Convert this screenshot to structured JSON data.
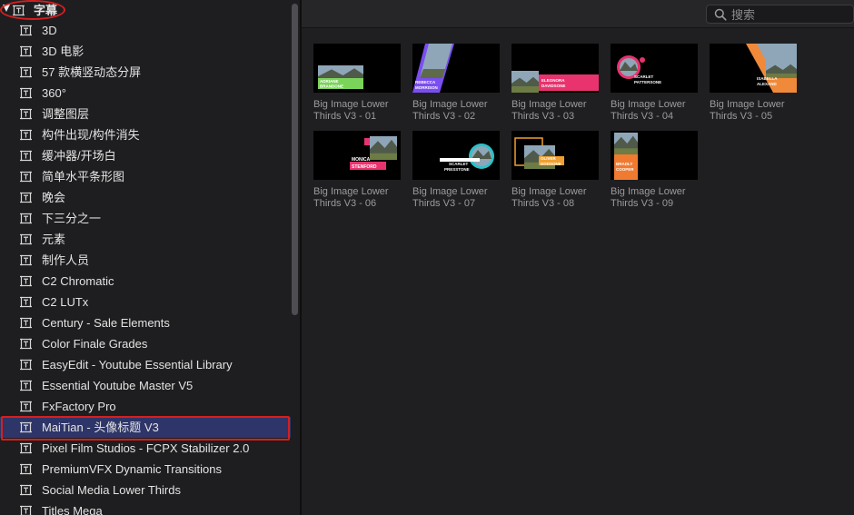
{
  "sidebar": {
    "header": {
      "label": "字幕"
    },
    "items": [
      {
        "label": "3D"
      },
      {
        "label": "3D 电影"
      },
      {
        "label": "57 款横竖动态分屏"
      },
      {
        "label": "360°"
      },
      {
        "label": "调整图层"
      },
      {
        "label": "构件出现/构件消失"
      },
      {
        "label": "缓冲器/开场白"
      },
      {
        "label": "简单水平条形图"
      },
      {
        "label": "晚会"
      },
      {
        "label": "下三分之一"
      },
      {
        "label": "元素"
      },
      {
        "label": "制作人员"
      },
      {
        "label": "C2 Chromatic"
      },
      {
        "label": "C2 LUTx"
      },
      {
        "label": "Century - Sale Elements"
      },
      {
        "label": "Color Finale Grades"
      },
      {
        "label": "EasyEdit - Youtube Essential Library"
      },
      {
        "label": "Essential Youtube Master V5"
      },
      {
        "label": "FxFactory Pro"
      },
      {
        "label": "MaiTian - 头像标题 V3",
        "selected": true
      },
      {
        "label": "Pixel Film Studios - FCPX Stabilizer 2.0"
      },
      {
        "label": "PremiumVFX Dynamic Transitions"
      },
      {
        "label": "Social Media Lower Thirds"
      },
      {
        "label": "Titles Mega"
      }
    ]
  },
  "search": {
    "placeholder": "搜索",
    "icon": "search-icon"
  },
  "browser": {
    "items": [
      {
        "title": "Big Image Lower Thirds V3 - 01",
        "line1": "Big Image Lower",
        "line2": "Thirds V3 - 01",
        "name_text": [
          "ADRIANE",
          "BRANDONE"
        ],
        "accent": "#7bd45a"
      },
      {
        "title": "Big Image Lower Thirds V3 - 02",
        "line1": "Big Image Lower",
        "line2": "Thirds V3 - 02",
        "name_text": [
          "REBECCA",
          "MORRISON"
        ],
        "accent": "#7a4ef0"
      },
      {
        "title": "Big Image Lower Thirds V3 - 03",
        "line1": "Big Image Lower",
        "line2": "Thirds V3 - 03",
        "name_text": [
          "ELEONORA",
          "DAVIDSONE"
        ],
        "accent": "#e8336e"
      },
      {
        "title": "Big Image Lower Thirds V3 - 04",
        "line1": "Big Image Lower",
        "line2": "Thirds V3 - 04",
        "name_text": [
          "SCARLET",
          "PATTERSONE"
        ],
        "accent": "#e8336e"
      },
      {
        "title": "Big Image Lower Thirds V3 - 05",
        "line1": "Big Image Lower",
        "line2": "Thirds V3 - 05",
        "name_text": [
          "ISABELLA",
          "ALEXAND"
        ],
        "accent": "#f08a3a"
      },
      {
        "title": "Big Image Lower Thirds V3 - 06",
        "line1": "Big Image Lower",
        "line2": "Thirds V3 - 06",
        "name_text": [
          "MONICA",
          "STENFORD"
        ],
        "accent": "#e8336e"
      },
      {
        "title": "Big Image Lower Thirds V3 - 07",
        "line1": "Big Image Lower",
        "line2": "Thirds V3 - 07",
        "name_text": [
          "SCARLET",
          "PRESSTONE"
        ],
        "accent": "#2fc0c8"
      },
      {
        "title": "Big Image Lower Thirds V3 - 08",
        "line1": "Big Image Lower",
        "line2": "Thirds V3 - 08",
        "name_text": [
          "OLIVER",
          "DODSONE"
        ],
        "accent": "#f0a030"
      },
      {
        "title": "Big Image Lower Thirds V3 - 09",
        "line1": "Big Image Lower",
        "line2": "Thirds V3 - 09",
        "name_text": [
          "BRADLY",
          "COOPER"
        ],
        "accent": "#f07a30"
      }
    ]
  },
  "colors": {
    "selection": "#2e3568",
    "annotation": "#d81e1e"
  }
}
